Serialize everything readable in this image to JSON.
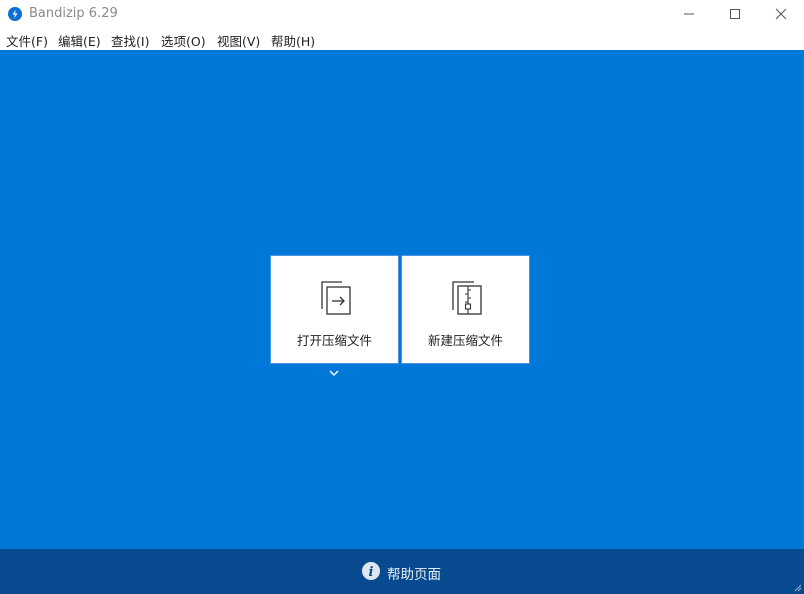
{
  "window": {
    "title": "Bandizip 6.29",
    "icon": "bandizip-logo-icon"
  },
  "menu": {
    "items": [
      {
        "label": "文件(F)"
      },
      {
        "label": "编辑(E)"
      },
      {
        "label": "查找(I)"
      },
      {
        "label": "选项(O)"
      },
      {
        "label": "视图(V)"
      },
      {
        "label": "帮助(H)"
      }
    ]
  },
  "actions": {
    "open_archive": {
      "label": "打开压缩文件",
      "icon": "open-archive-icon"
    },
    "new_archive": {
      "label": "新建压缩文件",
      "icon": "new-archive-icon"
    }
  },
  "footer": {
    "help_label": "帮助页面",
    "icon": "info-icon"
  },
  "colors": {
    "background": "#0078d7",
    "footer": "#074a8f",
    "card": "#ffffff",
    "accent": "#0b6fd4"
  }
}
